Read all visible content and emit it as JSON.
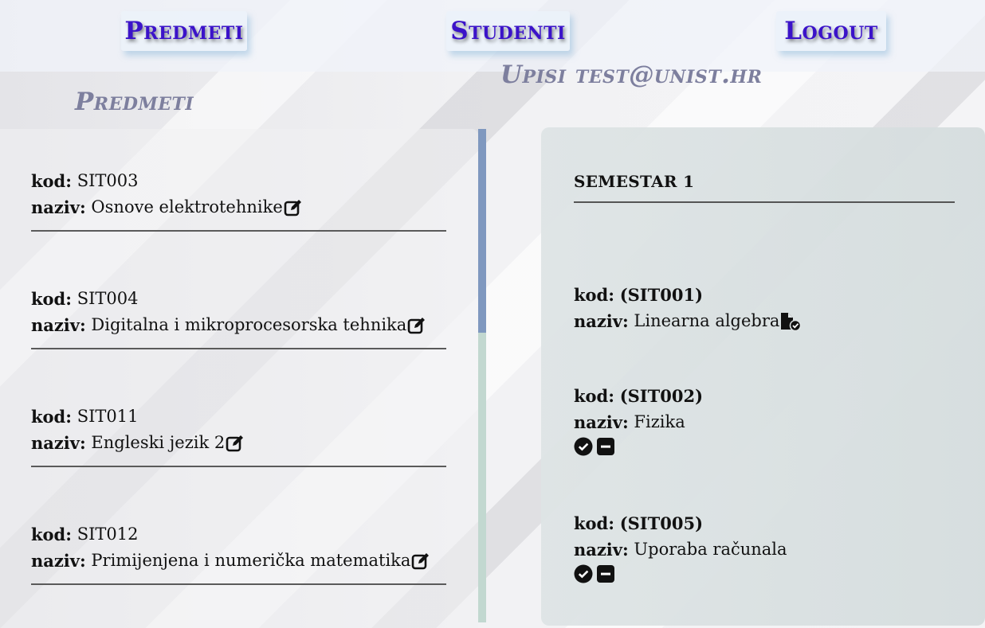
{
  "nav": {
    "predmeti": "Predmeti",
    "studenti": "Studenti",
    "logout": "Logout"
  },
  "upisi_title": "Upisi test@unist.hr",
  "predmeti_title": "Predmeti",
  "subjects": [
    {
      "kod_label": "kod:",
      "kod": "SIT003",
      "naziv_label": "naziv:",
      "naziv": "Osnove elektrotehnike"
    },
    {
      "kod_label": "kod:",
      "kod": "SIT004",
      "naziv_label": "naziv:",
      "naziv": "Digitalna i mikroprocesorska tehnika"
    },
    {
      "kod_label": "kod:",
      "kod": "SIT011",
      "naziv_label": "naziv:",
      "naziv": "Engleski jezik 2"
    },
    {
      "kod_label": "kod:",
      "kod": "SIT012",
      "naziv_label": "naziv:",
      "naziv": "Primijenjena i numerička matematika"
    }
  ],
  "semester": {
    "title": "SEMESTAR 1",
    "items": [
      {
        "kod_label": "kod:",
        "kod": "(SIT001)",
        "naziv_label": "naziv:",
        "naziv": "Linearna algebra",
        "icons": [
          "file-check-icon"
        ]
      },
      {
        "kod_label": "kod:",
        "kod": "(SIT002)",
        "naziv_label": "naziv:",
        "naziv": "Fizika",
        "icons": [
          "check-circle-icon",
          "minus-square-icon"
        ]
      },
      {
        "kod_label": "kod:",
        "kod": "(SIT005)",
        "naziv_label": "naziv:",
        "naziv": "Uporaba računala",
        "icons": [
          "check-circle-icon",
          "minus-square-icon"
        ]
      }
    ]
  },
  "colors": {
    "nav_text": "#3b13c9",
    "heading_text": "#7d7f9e",
    "scroll_thumb": "#7f98bf",
    "scroll_track": "#c2d8d0"
  }
}
